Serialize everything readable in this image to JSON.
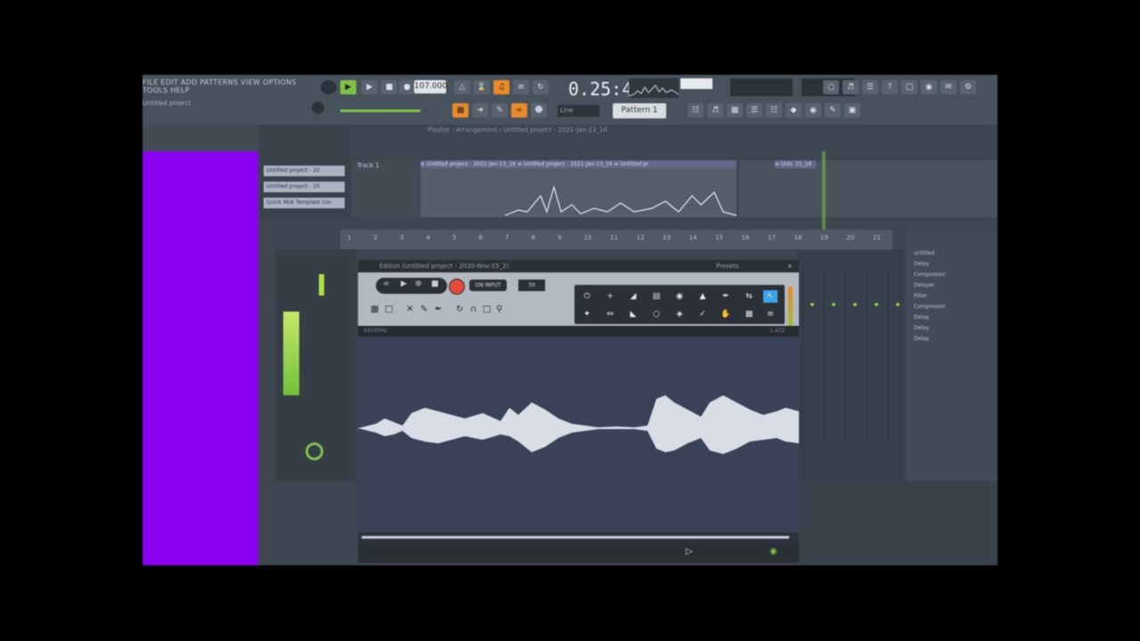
{
  "menu": {
    "items_text": "FILE EDIT ADD PATTERNS VIEW OPTIONS TOOLS HELP",
    "hint_text": "Untitled project"
  },
  "toolbar": {
    "tempo": "107.000",
    "time": "0.25:45",
    "pattern": "Pattern 1",
    "snap": "Line"
  },
  "browser": {
    "accent_color": "#8a00f0"
  },
  "playlist": {
    "title": "Playlist - Arrangement › Untitled project - 2021-Jan-13_16",
    "patterns": [
      "Untitled project - 20",
      "Untitled project - 20",
      "Quick Midi Template (Un"
    ],
    "track_label": "Track 1",
    "clip_label": "≡ Untitled project - 2021-Jan-13_16 ≡ Untitled project - 2021-Jan-13_16 ≡ Untitled pr",
    "clip2_label": "≡ Unti. 21_16",
    "ruler": [
      "1",
      "2",
      "3",
      "4",
      "5",
      "6",
      "7",
      "8",
      "9",
      "10",
      "11",
      "12",
      "13",
      "14",
      "15",
      "16",
      "17",
      "18",
      "19",
      "20",
      "21"
    ]
  },
  "edison": {
    "title": "Edison (Untitled project - 2020-Nov-15_2)",
    "on_input": "ON INPUT",
    "mode": "30",
    "status_left": "44100Hz",
    "status_right": "1.432",
    "presets": "Presets"
  },
  "side_panel": {
    "items": [
      "untitled",
      "Delay",
      "Compressor",
      "Delayer",
      "Filter",
      "Compressor",
      "Delay",
      "Delay",
      "Delay"
    ]
  }
}
